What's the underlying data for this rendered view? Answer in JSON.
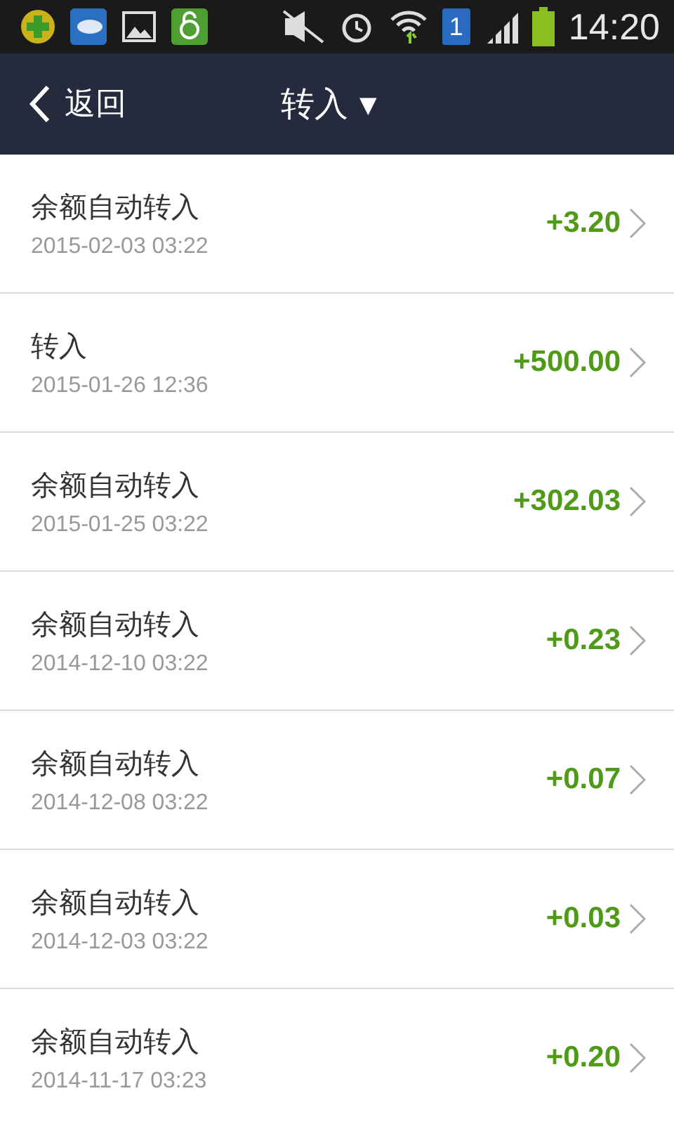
{
  "status_bar": {
    "sim": "1",
    "time": "14:20"
  },
  "header": {
    "back": "返回",
    "title": "转入",
    "dropdown": "▼"
  },
  "records": [
    {
      "title": "余额自动转入",
      "date": "2015-02-03 03:22",
      "amount": "+3.20"
    },
    {
      "title": "转入",
      "date": "2015-01-26 12:36",
      "amount": "+500.00"
    },
    {
      "title": "余额自动转入",
      "date": "2015-01-25 03:22",
      "amount": "+302.03"
    },
    {
      "title": "余额自动转入",
      "date": "2014-12-10 03:22",
      "amount": "+0.23"
    },
    {
      "title": "余额自动转入",
      "date": "2014-12-08 03:22",
      "amount": "+0.07"
    },
    {
      "title": "余额自动转入",
      "date": "2014-12-03 03:22",
      "amount": "+0.03"
    },
    {
      "title": "余额自动转入",
      "date": "2014-11-17 03:23",
      "amount": "+0.20"
    }
  ]
}
